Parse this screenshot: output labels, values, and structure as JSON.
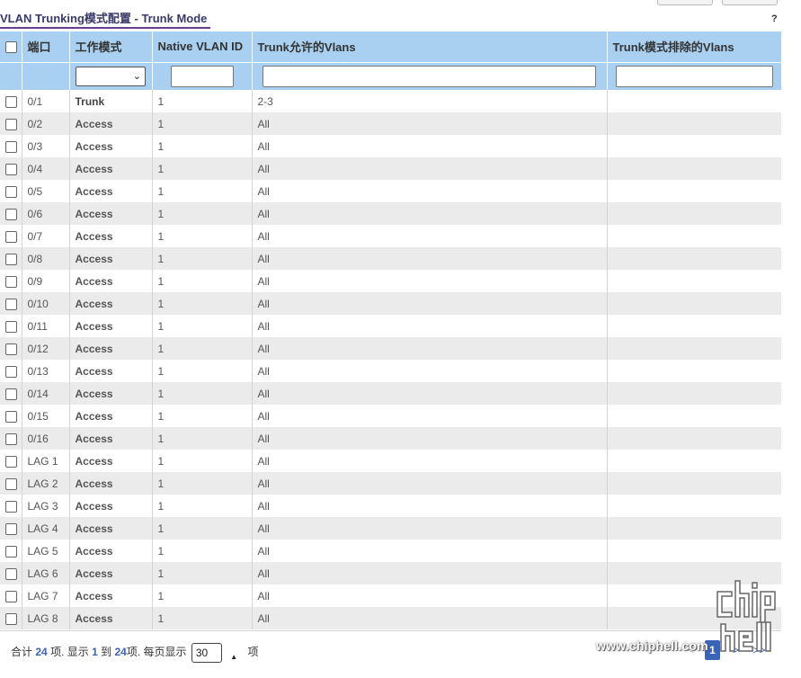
{
  "header": {
    "title": "VLAN Trunking模式配置 - Trunk Mode",
    "help_label": "?"
  },
  "table": {
    "columns": {
      "port": "端口",
      "mode": "工作模式",
      "native_vlan": "Native VLAN ID",
      "allowed_vlans": "Trunk允许的Vlans",
      "excluded_vlans": "Trunk模式排除的Vlans"
    },
    "filters": {
      "mode_selected": "",
      "native_vlan": "",
      "allowed_vlans": "",
      "excluded_vlans": ""
    },
    "rows": [
      {
        "port": "0/1",
        "mode": "Trunk",
        "native_vlan": "1",
        "allowed_vlans": "2-3",
        "excluded_vlans": ""
      },
      {
        "port": "0/2",
        "mode": "Access",
        "native_vlan": "1",
        "allowed_vlans": "All",
        "excluded_vlans": ""
      },
      {
        "port": "0/3",
        "mode": "Access",
        "native_vlan": "1",
        "allowed_vlans": "All",
        "excluded_vlans": ""
      },
      {
        "port": "0/4",
        "mode": "Access",
        "native_vlan": "1",
        "allowed_vlans": "All",
        "excluded_vlans": ""
      },
      {
        "port": "0/5",
        "mode": "Access",
        "native_vlan": "1",
        "allowed_vlans": "All",
        "excluded_vlans": ""
      },
      {
        "port": "0/6",
        "mode": "Access",
        "native_vlan": "1",
        "allowed_vlans": "All",
        "excluded_vlans": ""
      },
      {
        "port": "0/7",
        "mode": "Access",
        "native_vlan": "1",
        "allowed_vlans": "All",
        "excluded_vlans": ""
      },
      {
        "port": "0/8",
        "mode": "Access",
        "native_vlan": "1",
        "allowed_vlans": "All",
        "excluded_vlans": ""
      },
      {
        "port": "0/9",
        "mode": "Access",
        "native_vlan": "1",
        "allowed_vlans": "All",
        "excluded_vlans": ""
      },
      {
        "port": "0/10",
        "mode": "Access",
        "native_vlan": "1",
        "allowed_vlans": "All",
        "excluded_vlans": ""
      },
      {
        "port": "0/11",
        "mode": "Access",
        "native_vlan": "1",
        "allowed_vlans": "All",
        "excluded_vlans": ""
      },
      {
        "port": "0/12",
        "mode": "Access",
        "native_vlan": "1",
        "allowed_vlans": "All",
        "excluded_vlans": ""
      },
      {
        "port": "0/13",
        "mode": "Access",
        "native_vlan": "1",
        "allowed_vlans": "All",
        "excluded_vlans": ""
      },
      {
        "port": "0/14",
        "mode": "Access",
        "native_vlan": "1",
        "allowed_vlans": "All",
        "excluded_vlans": ""
      },
      {
        "port": "0/15",
        "mode": "Access",
        "native_vlan": "1",
        "allowed_vlans": "All",
        "excluded_vlans": ""
      },
      {
        "port": "0/16",
        "mode": "Access",
        "native_vlan": "1",
        "allowed_vlans": "All",
        "excluded_vlans": ""
      },
      {
        "port": "LAG 1",
        "mode": "Access",
        "native_vlan": "1",
        "allowed_vlans": "All",
        "excluded_vlans": ""
      },
      {
        "port": "LAG 2",
        "mode": "Access",
        "native_vlan": "1",
        "allowed_vlans": "All",
        "excluded_vlans": ""
      },
      {
        "port": "LAG 3",
        "mode": "Access",
        "native_vlan": "1",
        "allowed_vlans": "All",
        "excluded_vlans": ""
      },
      {
        "port": "LAG 4",
        "mode": "Access",
        "native_vlan": "1",
        "allowed_vlans": "All",
        "excluded_vlans": ""
      },
      {
        "port": "LAG 5",
        "mode": "Access",
        "native_vlan": "1",
        "allowed_vlans": "All",
        "excluded_vlans": ""
      },
      {
        "port": "LAG 6",
        "mode": "Access",
        "native_vlan": "1",
        "allowed_vlans": "All",
        "excluded_vlans": ""
      },
      {
        "port": "LAG 7",
        "mode": "Access",
        "native_vlan": "1",
        "allowed_vlans": "All",
        "excluded_vlans": ""
      },
      {
        "port": "LAG 8",
        "mode": "Access",
        "native_vlan": "1",
        "allowed_vlans": "All",
        "excluded_vlans": ""
      }
    ]
  },
  "footer": {
    "total_prefix": "合计",
    "total": "24",
    "total_suffix": "项. 显示",
    "from": "1",
    "to_word": "到",
    "to": "24",
    "to_suffix": "项. 每页显示",
    "per_page": "30",
    "per_page_suffix": "项",
    "pager": {
      "prev": "<",
      "current": "1",
      "next": ">",
      "last": ">>"
    }
  },
  "watermark": {
    "text": "www.chiphell.com"
  },
  "colors": {
    "header_bg": "#a9d0f0",
    "row_alt": "#ebebeb",
    "accent": "#3a64b8",
    "title_underline": "#6b3d8f"
  }
}
